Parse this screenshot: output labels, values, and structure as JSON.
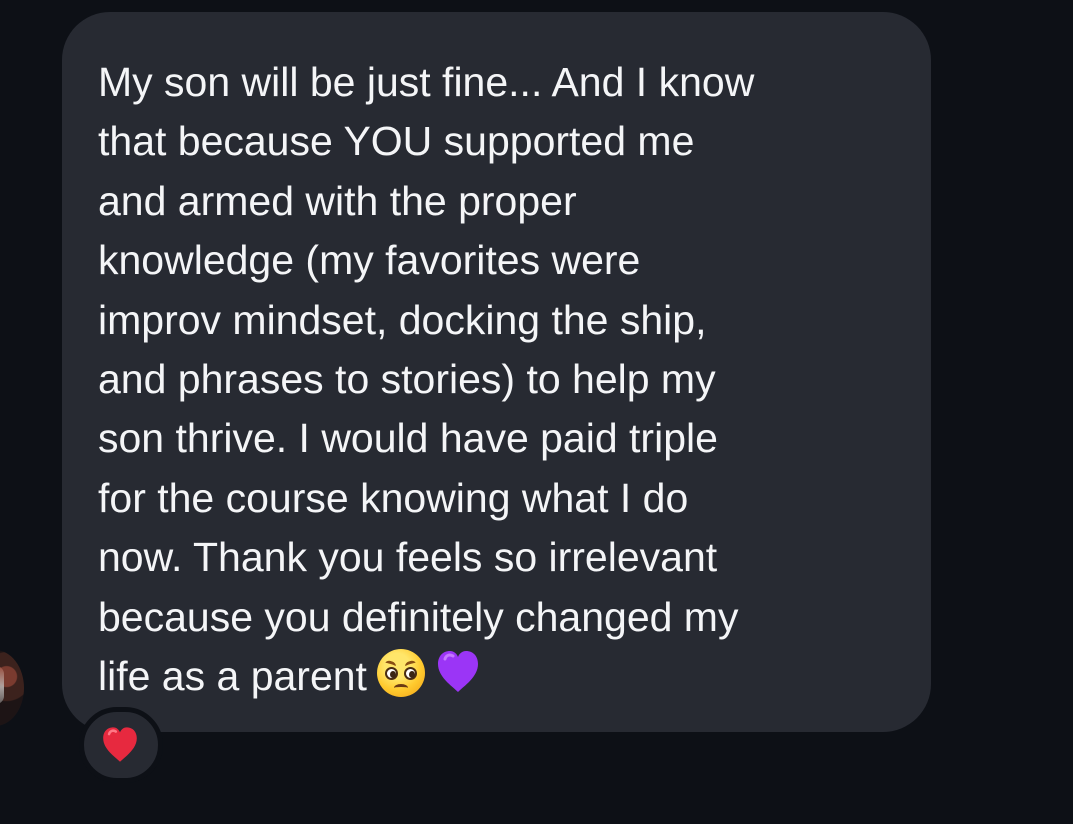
{
  "message": {
    "lines": [
      "My son will be just fine... And I know",
      "that because YOU supported me",
      "and armed with the proper",
      "knowledge (my favorites were",
      "improv mindset, docking the ship,",
      "and phrases to stories) to help my",
      "son thrive. I would have paid triple",
      "for the course knowing what I do",
      "now. Thank you feels so irrelevant",
      "because you definitely changed my",
      "life as a parent"
    ],
    "emojis": [
      "pleading-face",
      "purple-heart"
    ]
  },
  "reaction": {
    "emoji": "red-heart"
  },
  "colors": {
    "background": "#0d1016",
    "bubble": "#272a32",
    "text": "#f4f5f7",
    "purple_heart": "#9b35f6",
    "red_heart": "#e7293f"
  }
}
